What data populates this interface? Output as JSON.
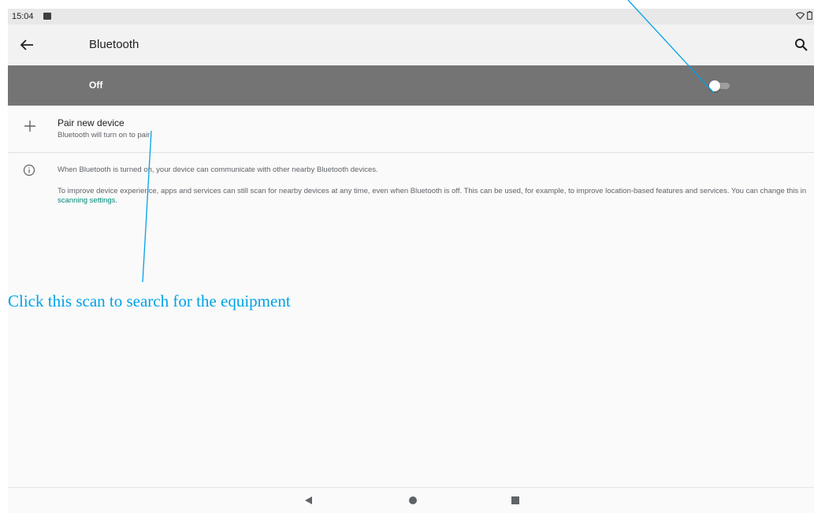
{
  "status_bar": {
    "time": "15:04",
    "icons": [
      "image-notification-icon",
      "wifi-icon",
      "battery-icon"
    ]
  },
  "toolbar": {
    "title": "Bluetooth",
    "back_icon": "arrow-back-icon",
    "search_icon": "search-icon"
  },
  "master_switch": {
    "label": "Off",
    "state": false,
    "bar_color": "#747474"
  },
  "pair_new_device": {
    "icon": "plus-icon",
    "title": "Pair new device",
    "subtitle": "Bluetooth will turn on to pair"
  },
  "info": {
    "icon": "info-icon",
    "line1": "When Bluetooth is turned on, your device can communicate with other nearby Bluetooth devices.",
    "line2_before": "To improve device experience, apps and services can still scan for nearby devices at any time, even when Bluetooth is off. This can be used, for example, to improve location-based features and services. You can change this in ",
    "link_text": "scanning settings",
    "line2_after": ".",
    "link_color": "#00897b"
  },
  "nav_bar": {
    "buttons": [
      "nav-back-icon",
      "nav-home-icon",
      "nav-recents-icon"
    ]
  },
  "annotation": {
    "text": "Click this scan to search for the equipment",
    "color": "#00a2e8"
  }
}
